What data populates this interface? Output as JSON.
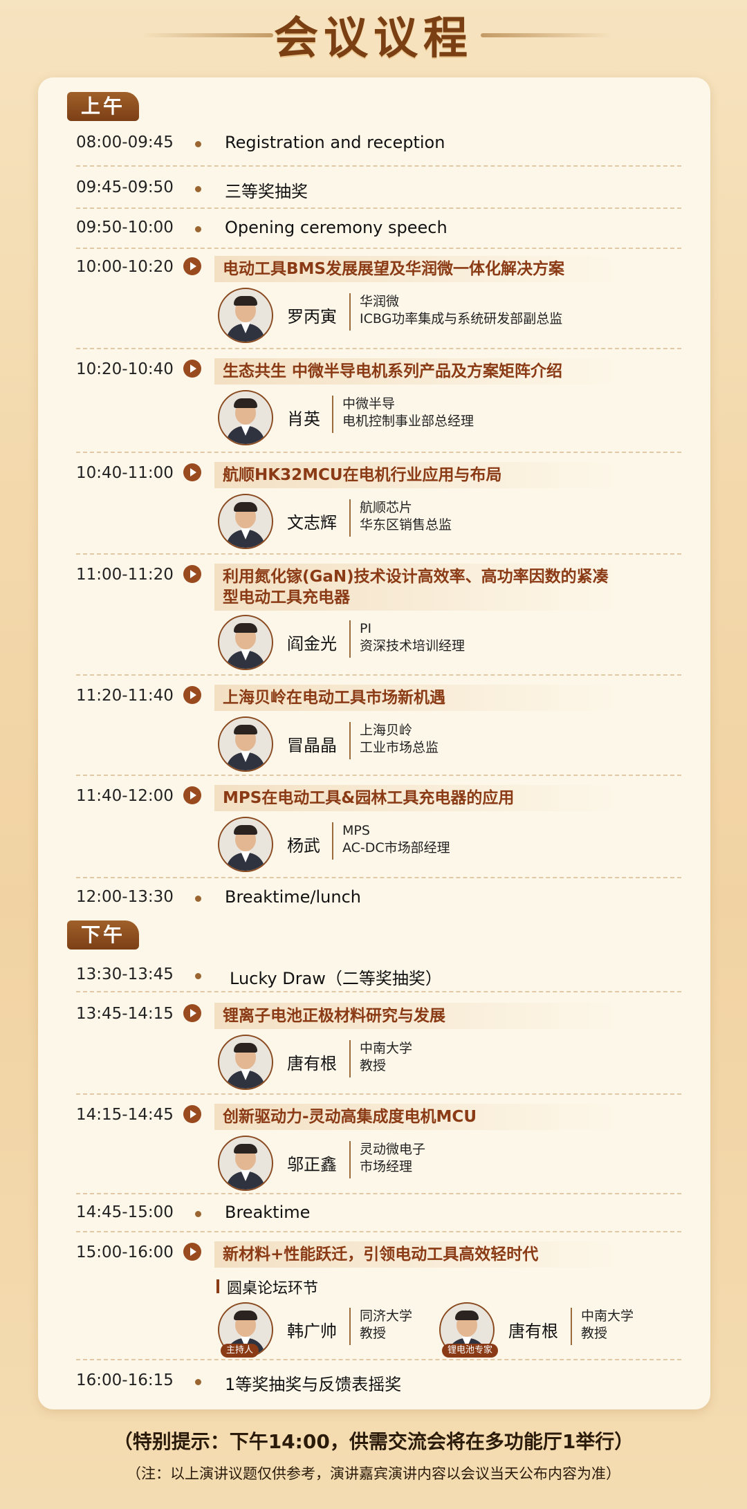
{
  "title": "会议议程",
  "sections": {
    "am": "上午",
    "pm": "下午"
  },
  "items": [
    {
      "time": "08:00-09:45",
      "text": "Registration and reception"
    },
    {
      "time": "09:45-09:50",
      "text": "三等奖抽奖"
    },
    {
      "time": "09:50-10:00",
      "text": "Opening ceremony speech"
    },
    {
      "time": "10:00-10:20",
      "topic": "电动工具BMS发展展望及华润微一体化解决方案",
      "speaker": {
        "name": "罗丙寅",
        "org1": "华润微",
        "org2": "ICBG功率集成与系统研发部副总监"
      }
    },
    {
      "time": "10:20-10:40",
      "topic": "生态共生 中微半导电机系列产品及方案矩阵介绍",
      "speaker": {
        "name": "肖英",
        "org1": "中微半导",
        "org2": "电机控制事业部总经理"
      }
    },
    {
      "time": "10:40-11:00",
      "topic": "航顺HK32MCU在电机行业应用与布局",
      "speaker": {
        "name": "文志辉",
        "org1": "航顺芯片",
        "org2": "华东区销售总监"
      }
    },
    {
      "time": "11:00-11:20",
      "topic": "利用氮化镓(GaN)技术设计高效率、高功率因数的紧凑型电动工具充电器",
      "speaker": {
        "name": "阎金光",
        "org1": "PI",
        "org2": "资深技术培训经理"
      }
    },
    {
      "time": "11:20-11:40",
      "topic": "上海贝岭在电动工具市场新机遇",
      "speaker": {
        "name": "冒晶晶",
        "org1": "上海贝岭",
        "org2": "工业市场总监"
      }
    },
    {
      "time": "11:40-12:00",
      "topic": "MPS在电动工具&园林工具充电器的应用",
      "speaker": {
        "name": "杨武",
        "org1": "MPS",
        "org2": "AC-DC市场部经理"
      }
    },
    {
      "time": "12:00-13:30",
      "text": "Breaktime/lunch"
    },
    {
      "time": "13:30-13:45",
      "text": "Lucky Draw（二等奖抽奖）"
    },
    {
      "time": "13:45-14:15",
      "topic": "锂离子电池正极材料研究与发展",
      "speaker": {
        "name": "唐有根",
        "org1": "中南大学",
        "org2": "教授"
      }
    },
    {
      "time": "14:15-14:45",
      "topic": "创新驱动力-灵动高集成度电机MCU",
      "speaker": {
        "name": "邬正鑫",
        "org1": "灵动微电子",
        "org2": "市场经理"
      }
    },
    {
      "time": "14:45-15:00",
      "text": "Breaktime"
    },
    {
      "time": "15:00-16:00",
      "topic": "新材料+性能跃迁，引领电动工具高效轻时代",
      "forum": "圆桌论坛环节",
      "panel": [
        {
          "name": "韩广帅",
          "org1": "同济大学",
          "org2": "教授",
          "badge": "主持人"
        },
        {
          "name": "唐有根",
          "org1": "中南大学",
          "org2": "教授",
          "badge": "锂电池专家"
        }
      ]
    },
    {
      "time": "16:00-16:15",
      "text": "1等奖抽奖与反馈表摇奖"
    }
  ],
  "footer": {
    "note1": "（特别提示：下午14:00，供需交流会将在多功能厅1举行）",
    "note2": "（注：以上演讲议题仅供参考，演讲嘉宾演讲内容以会议当天公布内容为准）"
  },
  "colors": {
    "accent": "#8a3a14",
    "background": "#f4dcb2",
    "card": "#fdf7e9"
  }
}
